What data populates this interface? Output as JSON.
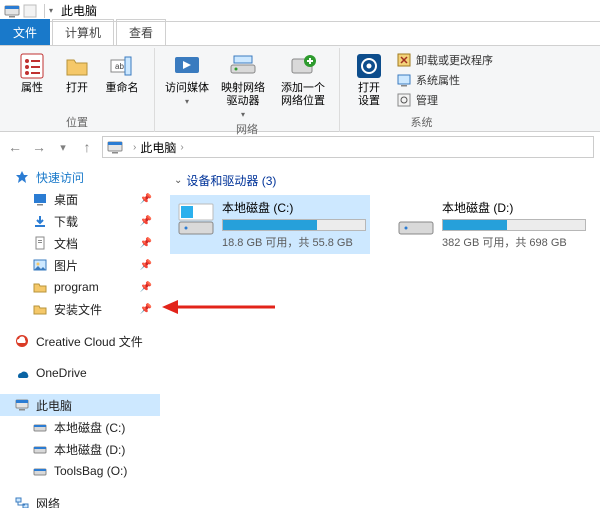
{
  "titlebar": {
    "title": "此电脑",
    "dropdown": "▾"
  },
  "tabs": [
    {
      "label": "文件",
      "active": true
    },
    {
      "label": "计算机",
      "active": false
    },
    {
      "label": "查看",
      "active": false
    }
  ],
  "ribbon": {
    "groups": [
      {
        "name": "位置",
        "big": [
          {
            "id": "properties-button",
            "label": "属性",
            "icon": "properties"
          },
          {
            "id": "open-button",
            "label": "打开",
            "icon": "open"
          },
          {
            "id": "rename-button",
            "label": "重命名",
            "icon": "rename"
          }
        ]
      },
      {
        "name": "网络",
        "big": [
          {
            "id": "access-media-button",
            "label": "访问媒体",
            "icon": "media",
            "drop": true
          },
          {
            "id": "map-drive-button",
            "label": "映射网络\n驱动器",
            "icon": "mapdrive",
            "drop": true
          },
          {
            "id": "add-netloc-button",
            "label": "添加一个\n网络位置",
            "icon": "addnet"
          }
        ]
      },
      {
        "name": "系统",
        "big": [
          {
            "id": "open-settings-button",
            "label": "打开\n设置",
            "icon": "settings"
          }
        ],
        "small": [
          {
            "id": "uninstall-button",
            "label": "卸载或更改程序",
            "icon": "uninstall"
          },
          {
            "id": "system-props-button",
            "label": "系统属性",
            "icon": "sysprops"
          },
          {
            "id": "manage-button",
            "label": "管理",
            "icon": "manage"
          }
        ]
      }
    ]
  },
  "addressbar": {
    "location": "此电脑",
    "sep": "›"
  },
  "sidebar": {
    "quick": {
      "title": "快速访问",
      "items": [
        {
          "label": "桌面",
          "icon": "desktop",
          "pinned": true
        },
        {
          "label": "下载",
          "icon": "downloads",
          "pinned": true
        },
        {
          "label": "文档",
          "icon": "documents",
          "pinned": true
        },
        {
          "label": "图片",
          "icon": "pictures",
          "pinned": true
        },
        {
          "label": "program",
          "icon": "folder",
          "pinned": true
        },
        {
          "label": "安装文件",
          "icon": "folder",
          "pinned": true
        }
      ]
    },
    "cc": {
      "label": "Creative Cloud 文件"
    },
    "onedrive": {
      "label": "OneDrive"
    },
    "thispc": {
      "label": "此电脑",
      "children": [
        {
          "label": "本地磁盘 (C:)",
          "icon": "drive"
        },
        {
          "label": "本地磁盘 (D:)",
          "icon": "drive"
        },
        {
          "label": "ToolsBag (O:)",
          "icon": "drive"
        }
      ]
    },
    "network": {
      "label": "网络"
    }
  },
  "content": {
    "section_title": "设备和驱动器 (3)",
    "drives": [
      {
        "name": "本地磁盘 (C:)",
        "free": "18.8 GB 可用，共 55.8 GB",
        "fill_pct": 66,
        "selected": true,
        "accent": false
      },
      {
        "name": "本地磁盘 (D:)",
        "free": "382 GB 可用，共 698 GB",
        "fill_pct": 45,
        "selected": false,
        "accent": false
      }
    ]
  },
  "colors": {
    "accent": "#1979ca",
    "selection": "#cde8ff"
  }
}
